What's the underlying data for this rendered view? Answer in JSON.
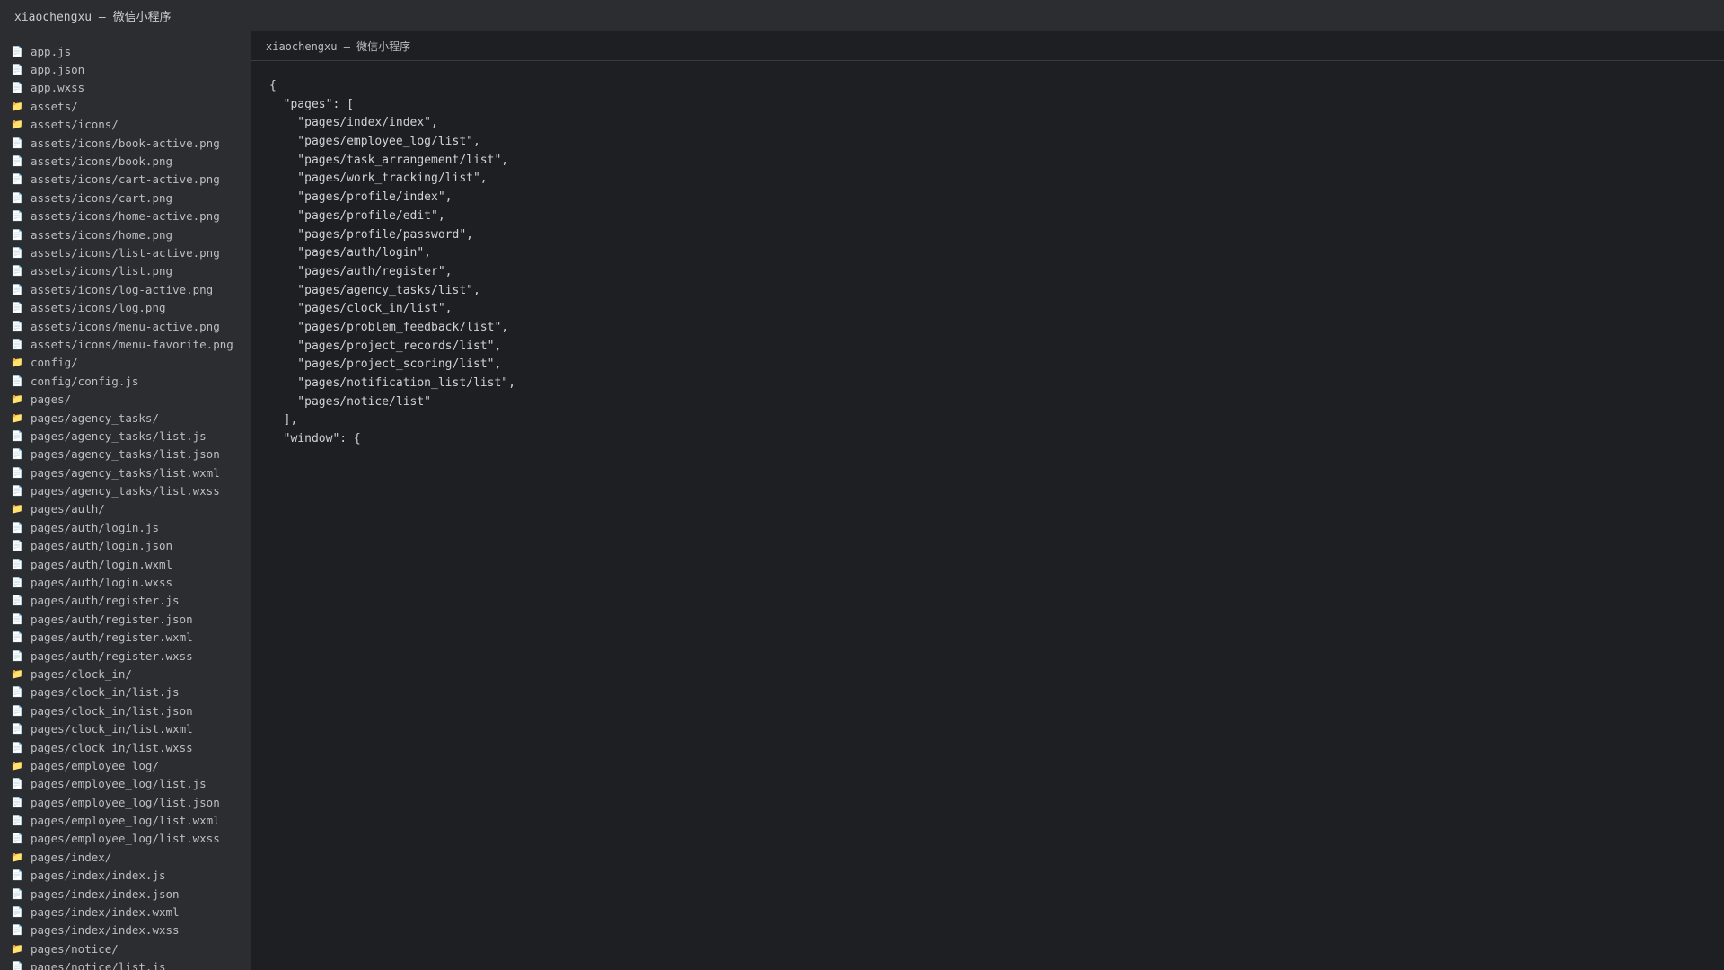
{
  "window": {
    "title": "xiaochengxu — 微信小程序"
  },
  "editor": {
    "header_title": "xiaochengxu — 微信小程序",
    "code_lines": [
      "{",
      "  \"pages\": [",
      "    \"pages/index/index\",",
      "    \"pages/employee_log/list\",",
      "    \"pages/task_arrangement/list\",",
      "    \"pages/work_tracking/list\",",
      "    \"pages/profile/index\",",
      "    \"pages/profile/edit\",",
      "    \"pages/profile/password\",",
      "    \"pages/auth/login\",",
      "    \"pages/auth/register\",",
      "    \"pages/agency_tasks/list\",",
      "    \"pages/clock_in/list\",",
      "    \"pages/problem_feedback/list\",",
      "    \"pages/project_records/list\",",
      "    \"pages/project_scoring/list\",",
      "    \"pages/notification_list/list\",",
      "    \"pages/notice/list\"",
      "  ],",
      "  \"window\": {"
    ]
  },
  "sidebar": {
    "files": [
      {
        "name": "app.js",
        "type": "file"
      },
      {
        "name": "app.json",
        "type": "file"
      },
      {
        "name": "app.wxss",
        "type": "file"
      },
      {
        "name": "assets/",
        "type": "folder"
      },
      {
        "name": "assets/icons/",
        "type": "folder"
      },
      {
        "name": "assets/icons/book-active.png",
        "type": "file"
      },
      {
        "name": "assets/icons/book.png",
        "type": "file"
      },
      {
        "name": "assets/icons/cart-active.png",
        "type": "file"
      },
      {
        "name": "assets/icons/cart.png",
        "type": "file"
      },
      {
        "name": "assets/icons/home-active.png",
        "type": "file"
      },
      {
        "name": "assets/icons/home.png",
        "type": "file"
      },
      {
        "name": "assets/icons/list-active.png",
        "type": "file"
      },
      {
        "name": "assets/icons/list.png",
        "type": "file"
      },
      {
        "name": "assets/icons/log-active.png",
        "type": "file"
      },
      {
        "name": "assets/icons/log.png",
        "type": "file"
      },
      {
        "name": "assets/icons/menu-active.png",
        "type": "file"
      },
      {
        "name": "assets/icons/menu-favorite.png",
        "type": "file"
      },
      {
        "name": "config/",
        "type": "folder"
      },
      {
        "name": "config/config.js",
        "type": "file"
      },
      {
        "name": "pages/",
        "type": "folder"
      },
      {
        "name": "pages/agency_tasks/",
        "type": "folder"
      },
      {
        "name": "pages/agency_tasks/list.js",
        "type": "file"
      },
      {
        "name": "pages/agency_tasks/list.json",
        "type": "file"
      },
      {
        "name": "pages/agency_tasks/list.wxml",
        "type": "file"
      },
      {
        "name": "pages/agency_tasks/list.wxss",
        "type": "file"
      },
      {
        "name": "pages/auth/",
        "type": "folder"
      },
      {
        "name": "pages/auth/login.js",
        "type": "file"
      },
      {
        "name": "pages/auth/login.json",
        "type": "file"
      },
      {
        "name": "pages/auth/login.wxml",
        "type": "file"
      },
      {
        "name": "pages/auth/login.wxss",
        "type": "file"
      },
      {
        "name": "pages/auth/register.js",
        "type": "file"
      },
      {
        "name": "pages/auth/register.json",
        "type": "file"
      },
      {
        "name": "pages/auth/register.wxml",
        "type": "file"
      },
      {
        "name": "pages/auth/register.wxss",
        "type": "file"
      },
      {
        "name": "pages/clock_in/",
        "type": "folder"
      },
      {
        "name": "pages/clock_in/list.js",
        "type": "file"
      },
      {
        "name": "pages/clock_in/list.json",
        "type": "file"
      },
      {
        "name": "pages/clock_in/list.wxml",
        "type": "file"
      },
      {
        "name": "pages/clock_in/list.wxss",
        "type": "file"
      },
      {
        "name": "pages/employee_log/",
        "type": "folder"
      },
      {
        "name": "pages/employee_log/list.js",
        "type": "file"
      },
      {
        "name": "pages/employee_log/list.json",
        "type": "file"
      },
      {
        "name": "pages/employee_log/list.wxml",
        "type": "file"
      },
      {
        "name": "pages/employee_log/list.wxss",
        "type": "file"
      },
      {
        "name": "pages/index/",
        "type": "folder"
      },
      {
        "name": "pages/index/index.js",
        "type": "file"
      },
      {
        "name": "pages/index/index.json",
        "type": "file"
      },
      {
        "name": "pages/index/index.wxml",
        "type": "file"
      },
      {
        "name": "pages/index/index.wxss",
        "type": "file"
      },
      {
        "name": "pages/notice/",
        "type": "folder"
      },
      {
        "name": "pages/notice/list.js",
        "type": "file"
      }
    ],
    "icons": {
      "file": "📄",
      "folder": "📁"
    }
  }
}
